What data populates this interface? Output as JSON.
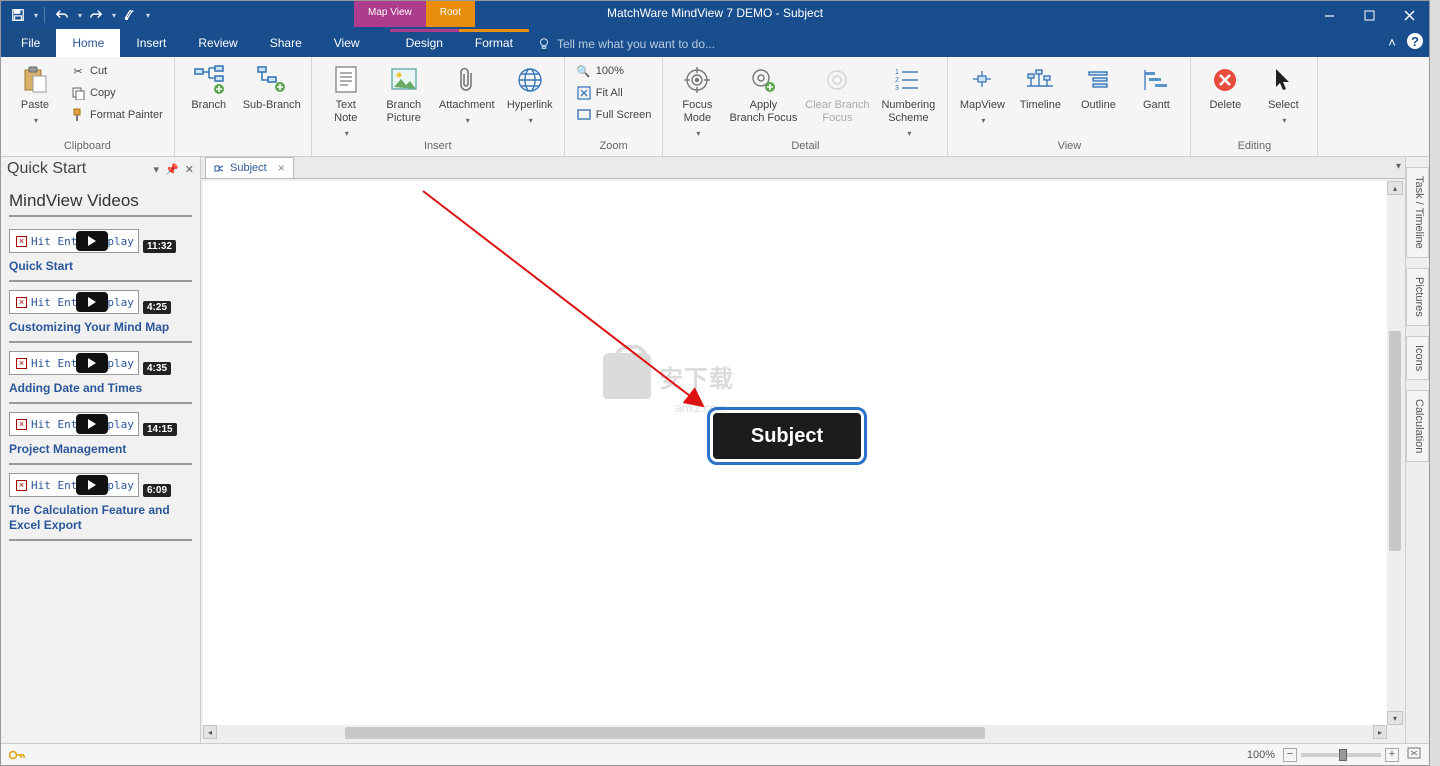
{
  "title": "MatchWare MindView 7 DEMO - Subject",
  "contextual_tabs": {
    "mapview": "Map View",
    "root": "Root"
  },
  "tabs": {
    "file": "File",
    "home": "Home",
    "insert": "Insert",
    "review": "Review",
    "share": "Share",
    "view": "View",
    "design": "Design",
    "format": "Format",
    "active": "home"
  },
  "tell_me_placeholder": "Tell me what you want to do...",
  "ribbon": {
    "clipboard": {
      "label": "Clipboard",
      "paste": "Paste",
      "cut": "Cut",
      "copy": "Copy",
      "format_painter": "Format Painter"
    },
    "branch_group": {
      "branch": "Branch",
      "sub_branch": "Sub-Branch"
    },
    "insert": {
      "label": "Insert",
      "text_note": "Text\nNote",
      "branch_picture": "Branch\nPicture",
      "attachment": "Attachment",
      "hyperlink": "Hyperlink"
    },
    "zoom": {
      "label": "Zoom",
      "p100": "100%",
      "fit_all": "Fit All",
      "full_screen": "Full Screen"
    },
    "detail": {
      "label": "Detail",
      "focus_mode": "Focus\nMode",
      "apply": "Apply\nBranch Focus",
      "clear": "Clear Branch\nFocus",
      "numbering": "Numbering\nScheme"
    },
    "view": {
      "label": "View",
      "mapview": "MapView",
      "timeline": "Timeline",
      "outline": "Outline",
      "gantt": "Gantt"
    },
    "editing": {
      "label": "Editing",
      "delete": "Delete",
      "select": "Select"
    }
  },
  "sidepanel": {
    "title": "Quick Start",
    "heading": "MindView Videos",
    "thumb_overlay": "Hit Enter⏵ play",
    "videos": [
      {
        "duration": "11:32",
        "title": "Quick Start"
      },
      {
        "duration": "4:25",
        "title": "Customizing Your Mind Map"
      },
      {
        "duration": "4:35",
        "title": "Adding Date and Times"
      },
      {
        "duration": "14:15",
        "title": "Project Management"
      },
      {
        "duration": "6:09",
        "title": "The Calculation Feature and Excel Export"
      }
    ]
  },
  "doc_tab": "Subject",
  "canvas_node": "Subject",
  "watermark": {
    "txt1": "安下载",
    "txt2": "anxz.com"
  },
  "right_tabs": [
    "Task / Timeline",
    "Pictures",
    "Icons",
    "Calculation"
  ],
  "status": {
    "zoom": "100%"
  }
}
